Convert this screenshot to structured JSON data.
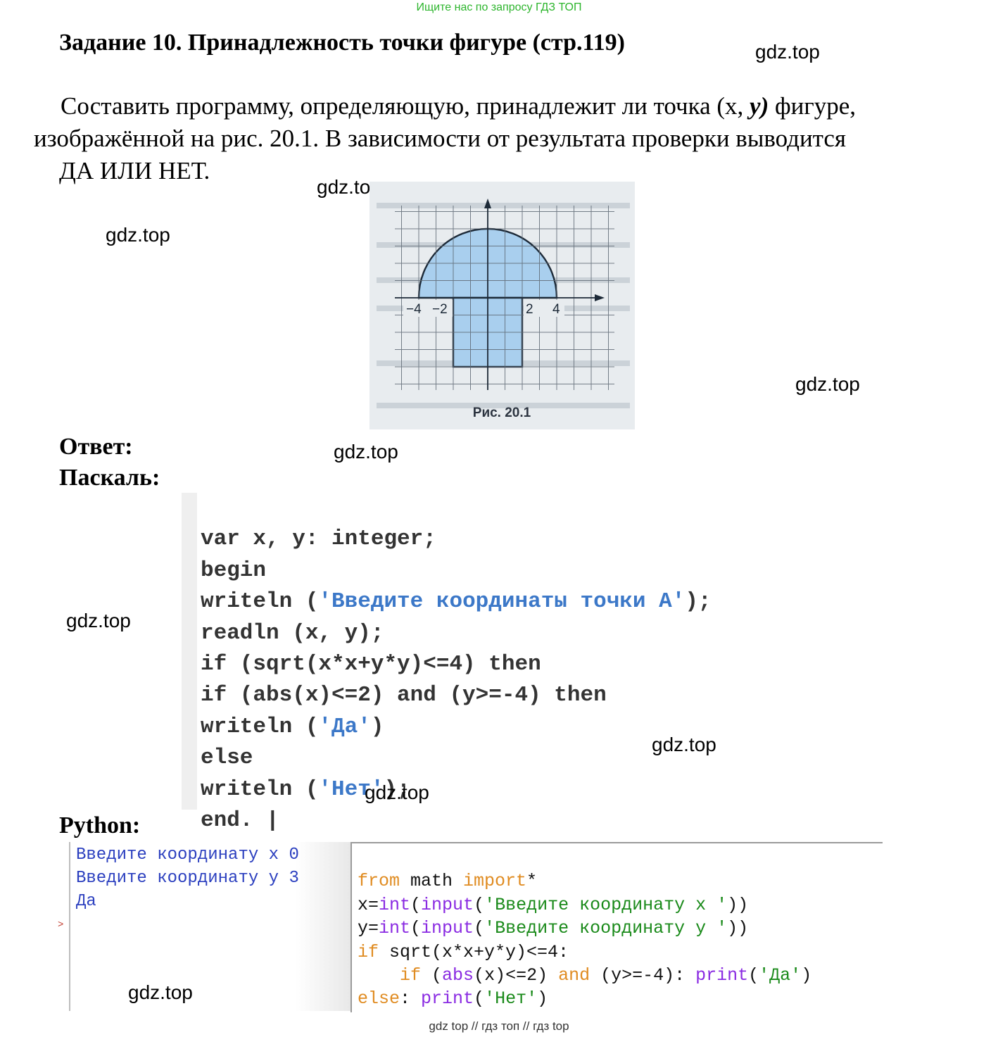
{
  "top_banner": "Ищите нас по запросу ГДЗ ТОП",
  "title": "Задание 10. Принадлежность точки фигуре (стр.119)",
  "task": {
    "line1_start": "Составить программу, определяющую, принадлежит ли точка (",
    "line1_x": "x, ",
    "line1_y": "y)",
    "line1_end": " фигуре,",
    "line2": "изображённой на рис. 20.1. В зависимости от результата проверки выводится",
    "line3": "ДА ИЛИ НЕТ."
  },
  "watermark": "gdz.top",
  "figure": {
    "caption": "Рис. 20.1",
    "tick_labels": [
      "−4",
      "−2",
      "2",
      "4"
    ],
    "fill_color": "#a9cfee",
    "grid_color": "#5f6a75"
  },
  "answer_label": "Ответ:",
  "pascal_label": "Паскаль:",
  "pascal": {
    "l1": "var x, y: integer;",
    "l2": "begin",
    "l3a": "writeln (",
    "l3b": "'Введите координаты точки А'",
    "l3c": ");",
    "l4": "readln (x, y);",
    "l5": "if (sqrt(x*x+y*y)<=4) then",
    "l6": "if (abs(x)<=2) and (y>=-4) then",
    "l7a": "writeln (",
    "l7b": "'Да'",
    "l7c": ")",
    "l8": "else",
    "l9a": "writeln (",
    "l9b": "'Нет'",
    "l9c": ");",
    "l10": "end. |"
  },
  "python_label": "Python:",
  "console": {
    "l1": "Введите координату x 0",
    "l2": "Введите координату y 3",
    "l3": "Да",
    "prompt": ">"
  },
  "python": {
    "from": "from",
    "math": " math ",
    "import": "import",
    "star": "*",
    "x_assign": "x=",
    "int": "int",
    "paren_open": "(",
    "input": "input",
    "prompt_x": "'Введите координату x '",
    "close2": "))",
    "y_assign": "y=",
    "prompt_y": "'Введите координату y '",
    "if": "if",
    "cond1": " sqrt(x*x+y*y)<=4:",
    "indent": "    ",
    "abs": "abs",
    "cond2a": "(x)<=2) ",
    "and": "and",
    "cond2b": " (y>=-4): ",
    "print": "print",
    "da": "'Да'",
    "close1": ")",
    "else": "else",
    "colon": ": ",
    "net": "'Нет'",
    "space": " ",
    "open_paren_sp": " ("
  },
  "bottom_banner": "gdz top  //  гдз топ  //  гдз top"
}
